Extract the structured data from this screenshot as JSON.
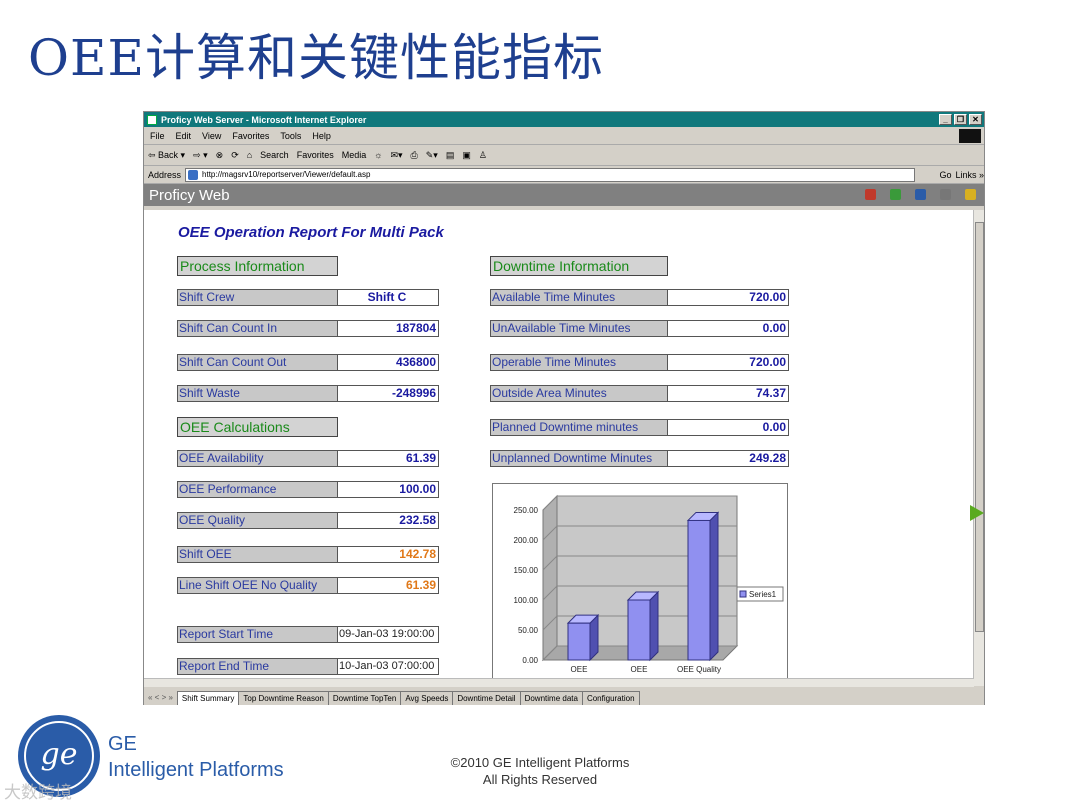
{
  "slide": {
    "title": "OEE计算和关键性能指标",
    "company_line1": "GE",
    "company_line2": "Intelligent Platforms",
    "copyright_line1": "©2010 GE Intelligent Platforms",
    "copyright_line2": "All Rights Reserved",
    "watermark": "大数跨境"
  },
  "browser": {
    "title": "Proficy Web Server - Microsoft Internet Explorer",
    "menu": [
      "File",
      "Edit",
      "View",
      "Favorites",
      "Tools",
      "Help"
    ],
    "toolbar": [
      "⇦ Back ▾",
      "⇨ ▾",
      "⊗",
      "⟳",
      "⌂",
      "Search",
      "Favorites",
      "Media",
      "☼",
      "✉▾",
      "⎙",
      "✎▾",
      "▤",
      "▣",
      "♙"
    ],
    "address_label": "Address",
    "address_value": "http://magsrv10/reportserver/Viewer/default.asp",
    "go_label": "Go",
    "links_label": "Links »"
  },
  "app": {
    "name": "Proficy Web",
    "icon_colors": [
      "#c0392b",
      "#3a9a3a",
      "#2a5ca8",
      "#777777",
      "#d8b020"
    ]
  },
  "report": {
    "title": "OEE Operation Report For Multi Pack",
    "process_header": "Process Information",
    "process": [
      {
        "label": "Shift Crew",
        "value": "Shift  C"
      },
      {
        "label": "Shift Can Count In",
        "value": "187804"
      },
      {
        "label": "Shift Can Count Out",
        "value": "436800"
      },
      {
        "label": "Shift Waste",
        "value": "-248996"
      }
    ],
    "calc_header": "OEE Calculations",
    "calc": [
      {
        "label": "OEE Availability",
        "value": "61.39"
      },
      {
        "label": "OEE Performance",
        "value": "100.00"
      },
      {
        "label": "OEE Quality",
        "value": "232.58"
      },
      {
        "label": "Shift OEE",
        "value": "142.78"
      },
      {
        "label": "Line Shift OEE No Quality",
        "value": "61.39"
      }
    ],
    "times": [
      {
        "label": "Report Start Time",
        "value": "09-Jan-03 19:00:00"
      },
      {
        "label": "Report End Time",
        "value": "10-Jan-03 07:00:00"
      }
    ],
    "downtime_header": "Downtime Information",
    "downtime": [
      {
        "label": "Available Time Minutes",
        "value": "720.00"
      },
      {
        "label": "UnAvailable Time Minutes",
        "value": "0.00"
      },
      {
        "label": "Operable Time Minutes",
        "value": "720.00"
      },
      {
        "label": "Outside Area Minutes",
        "value": "74.37"
      },
      {
        "label": "Planned Downtime minutes",
        "value": "0.00"
      },
      {
        "label": "Unplanned Downtime Minutes",
        "value": "249.28"
      }
    ]
  },
  "chart_data": {
    "type": "bar",
    "categories": [
      "OEE",
      "OEE",
      "OEE Quality"
    ],
    "series": [
      {
        "name": "Series1",
        "values": [
          61.39,
          100.0,
          232.58
        ]
      }
    ],
    "yticks": [
      "0.00",
      "50.00",
      "100.00",
      "150.00",
      "200.00",
      "250.00"
    ],
    "ylim": [
      0,
      250
    ],
    "legend": "right",
    "bar_color": "#9090f0"
  },
  "tabs": {
    "nav": "« < > »",
    "items": [
      "Shift Summary",
      "Top Downtime  Reason",
      "Downtime TopTen",
      "Avg Speeds",
      "Downtime Detail",
      "Downtime  data",
      "Configuration"
    ]
  }
}
